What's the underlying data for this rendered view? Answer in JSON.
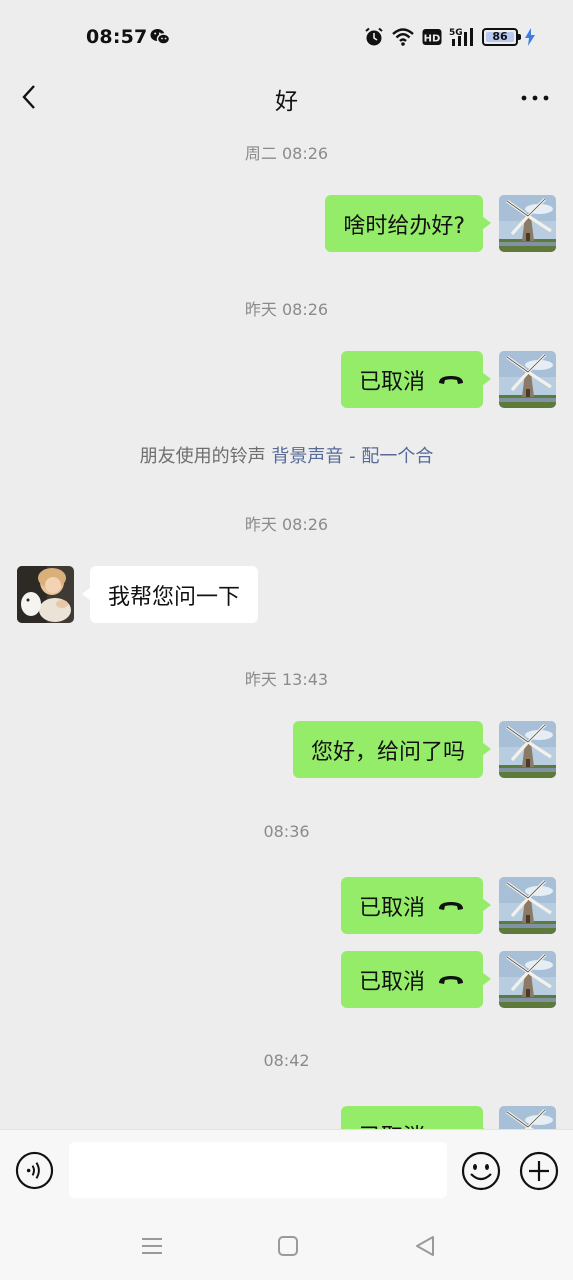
{
  "status_bar": {
    "time": "08:57",
    "battery": "86",
    "network": "5G",
    "hd": "HD",
    "icons": [
      "wechat-icon",
      "alarm-icon",
      "wifi-icon",
      "hd-icon",
      "signal-icon",
      "battery-icon",
      "charging-icon"
    ]
  },
  "nav": {
    "title": "好",
    "back_icon": "chevron-left-icon",
    "more_icon": "more-dots-icon"
  },
  "messages": [
    {
      "type": "time",
      "text": "周二 08:26"
    },
    {
      "type": "out",
      "text": "啥时给办好?"
    },
    {
      "type": "time",
      "text": "昨天 08:26"
    },
    {
      "type": "out",
      "text": "已取消",
      "icon": "call-cancelled-icon"
    },
    {
      "type": "system",
      "text": "朋友使用的铃声",
      "link": "背景声音 - 配一个合"
    },
    {
      "type": "time",
      "text": "昨天 08:26"
    },
    {
      "type": "in",
      "text": "我帮您问一下"
    },
    {
      "type": "time",
      "text": "昨天 13:43"
    },
    {
      "type": "out",
      "text": "您好，给问了吗"
    },
    {
      "type": "time",
      "text": "08:36"
    },
    {
      "type": "out",
      "text": "已取消",
      "icon": "call-cancelled-icon"
    },
    {
      "type": "out",
      "text": "已取消",
      "icon": "call-cancelled-icon"
    },
    {
      "type": "time",
      "text": "08:42"
    },
    {
      "type": "out",
      "text": "已取消",
      "icon": "call-cancelled-icon"
    }
  ],
  "input_bar": {
    "value": "",
    "icons": [
      "voice-icon",
      "emoji-icon",
      "plus-icon"
    ]
  },
  "colors": {
    "background": "#ededed",
    "bubble_out": "#95ec69",
    "bubble_in": "#ffffff",
    "link": "#576b95",
    "timestamp": "#8b8b8b"
  }
}
